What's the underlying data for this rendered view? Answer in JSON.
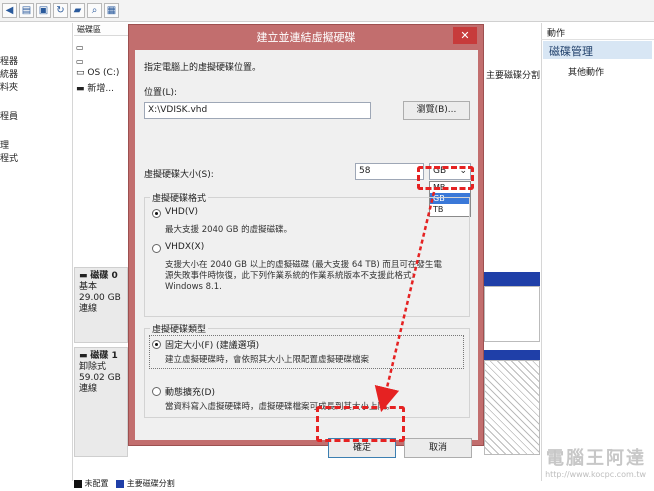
{
  "background": {
    "left_pane": [
      "程器",
      "統器",
      "料夾",
      "程員",
      "理",
      "程式"
    ],
    "volume_header": "磁碟區",
    "volumes": [
      "OS (C:)",
      "新增..."
    ],
    "right_label": "主要磁碟分割",
    "actions": {
      "header": "動作",
      "selected": "磁碟管理",
      "other": "其他動作"
    },
    "disks": [
      {
        "name": "磁碟 0",
        "type": "基本",
        "size": "29.00 GB",
        "status": "連線"
      },
      {
        "name": "磁碟 1",
        "type": "卸除式",
        "size": "59.02 GB",
        "status": "連線"
      }
    ],
    "legend": [
      {
        "label": "未配置",
        "color": "#111111"
      },
      {
        "label": "主要磁碟分割",
        "color": "#1f3fa8"
      }
    ]
  },
  "dialog": {
    "title": "建立並連結虛擬硬碟",
    "close": "✕",
    "instruction": "指定電腦上的虛擬硬碟位置。",
    "location_label": "位置(L):",
    "location_value": "X:\\VDISK.vhd",
    "browse_button": "瀏覽(B)...",
    "size_label": "虛擬硬碟大小(S):",
    "size_value": "58",
    "unit_selected": "GB",
    "unit_options": [
      "MB",
      "GB",
      "TB"
    ],
    "format_group": "虛擬硬碟格式",
    "vhd_label": "VHD(V)",
    "vhd_desc": "最大支援 2040 GB 的虛擬磁碟。",
    "vhdx_label": "VHDX(X)",
    "vhdx_desc": "支援大小在 2040 GB 以上的虛擬磁碟 (最大支援 64 TB) 而且可在發生電\n源失敗事件時恢復，此下列作業系統的作業系統版本不支援此格式:\nWindows 8.1.",
    "type_group": "虛擬硬碟類型",
    "fixed_label": "固定大小(F) (建議選項)",
    "fixed_desc": "建立虛擬硬碟時，會依照其大小上限配置虛擬硬碟檔案",
    "dynamic_label": "動態擴充(D)",
    "dynamic_desc": "當資料寫入虛擬硬碟時，虛擬硬碟檔案可成長到其大小上限。",
    "ok_button": "確定",
    "cancel_button": "取消"
  },
  "watermark": {
    "title": "電腦王阿達",
    "url": "http://www.kocpc.com.tw"
  },
  "colors": {
    "callout": "#e52222",
    "dialog_frame": "#c26e6e",
    "selected_option": "#3a78d8"
  }
}
